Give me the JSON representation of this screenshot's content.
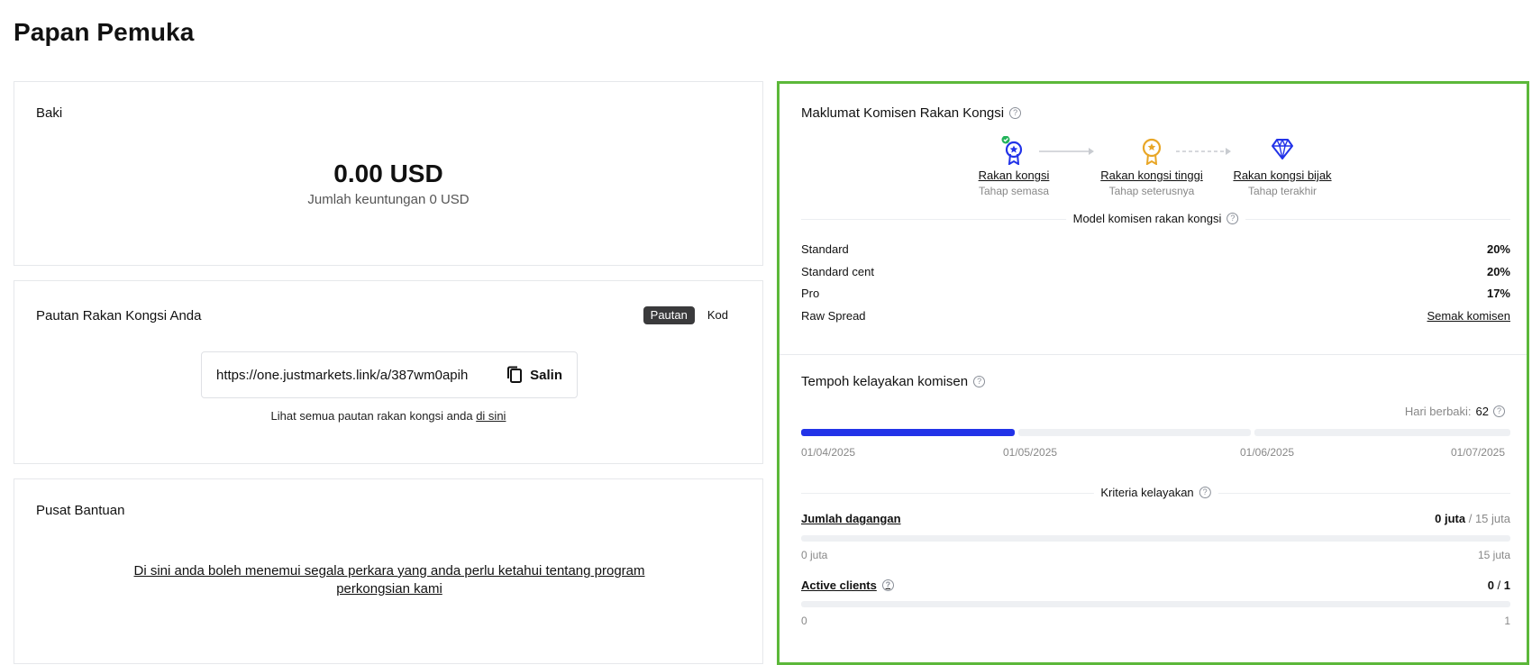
{
  "page": {
    "title": "Papan Pemuka"
  },
  "balance": {
    "title": "Baki",
    "amount": "0.00 USD",
    "subtitle": "Jumlah keuntungan 0 USD"
  },
  "partner_link": {
    "title": "Pautan Rakan Kongsi Anda",
    "toggle": {
      "link": "Pautan",
      "code": "Kod",
      "selected": "Pautan"
    },
    "url": "https://one.justmarkets.link/a/387wm0apih",
    "copy_label": "Salin",
    "note_prefix": "Lihat semua pautan rakan kongsi anda ",
    "note_link": "di sini"
  },
  "help": {
    "title": "Pusat Bantuan",
    "link_text": "Di sini anda boleh menemui segala perkara yang anda perlu ketahui tentang program perkongsian kami"
  },
  "commission": {
    "title": "Maklumat Komisen Rakan Kongsi",
    "tiers": [
      {
        "name": "Rakan kongsi",
        "stage": "Tahap semasa",
        "icon": "blue-medal-icon",
        "color": "#2233e8",
        "current": true
      },
      {
        "name": "Rakan kongsi tinggi",
        "stage": "Tahap seterusnya",
        "icon": "gold-medal-icon",
        "color": "#e8a626"
      },
      {
        "name": "Rakan kongsi bijak",
        "stage": "Tahap terakhir",
        "icon": "diamond-icon",
        "color": "#2233e8"
      }
    ],
    "model_label": "Model komisen rakan kongsi",
    "rows": [
      {
        "account": "Standard",
        "value": "20%"
      },
      {
        "account": "Standard cent",
        "value": "20%"
      },
      {
        "account": "Pro",
        "value": "17%"
      },
      {
        "account": "Raw Spread",
        "value": "Semak komisen"
      }
    ]
  },
  "eligibility": {
    "title": "Tempoh kelayakan komisen",
    "days_left_label": "Hari berbaki:",
    "days_left": "62",
    "progress_fraction": 0.318,
    "dates": [
      "01/04/2025",
      "01/05/2025",
      "01/06/2025",
      "01/07/2025"
    ],
    "criteria_label": "Kriteria kelayakan",
    "criteria": [
      {
        "name": "Jumlah dagangan",
        "current": "0 juta",
        "separator": " / ",
        "target": "15 juta",
        "min": "0 juta",
        "max": "15 juta",
        "fraction": 0
      },
      {
        "name": "Active clients",
        "current": "0",
        "separator": " / ",
        "target": "1",
        "min": "0",
        "max": "1",
        "fraction": 0
      }
    ]
  },
  "colors": {
    "accent": "#2233e8",
    "gold": "#e8a626",
    "highlight_border": "#5cb83a",
    "success": "#22b35a"
  }
}
